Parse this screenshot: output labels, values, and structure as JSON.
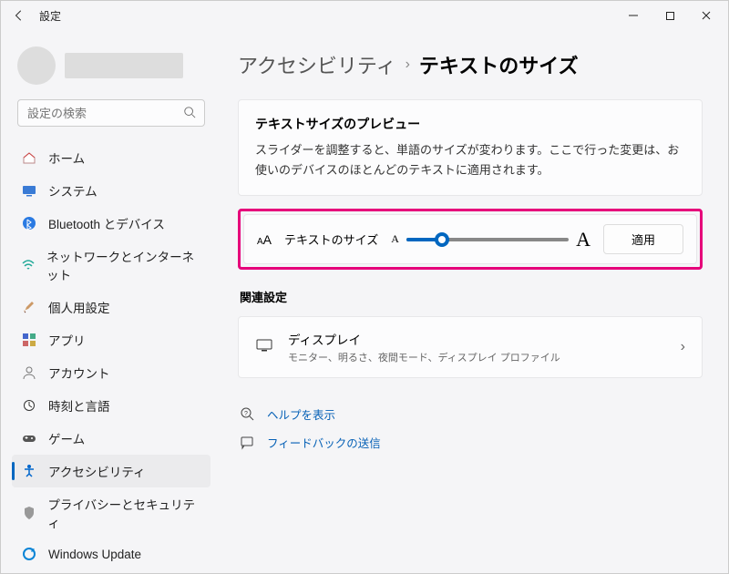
{
  "window": {
    "title": "設定"
  },
  "search": {
    "placeholder": "設定の検索"
  },
  "nav": {
    "items": [
      {
        "label": "ホーム"
      },
      {
        "label": "システム"
      },
      {
        "label": "Bluetooth とデバイス"
      },
      {
        "label": "ネットワークとインターネット"
      },
      {
        "label": "個人用設定"
      },
      {
        "label": "アプリ"
      },
      {
        "label": "アカウント"
      },
      {
        "label": "時刻と言語"
      },
      {
        "label": "ゲーム"
      },
      {
        "label": "アクセシビリティ"
      },
      {
        "label": "プライバシーとセキュリティ"
      },
      {
        "label": "Windows Update"
      }
    ]
  },
  "breadcrumb": {
    "parent": "アクセシビリティ",
    "current": "テキストのサイズ"
  },
  "preview": {
    "title": "テキストサイズのプレビュー",
    "description": "スライダーを調整すると、単語のサイズが変わります。ここで行った変更は、お使いのデバイスのほとんどのテキストに適用されます。"
  },
  "slider": {
    "label": "テキストのサイズ",
    "apply": "適用"
  },
  "related": {
    "heading": "関連設定",
    "display": {
      "title": "ディスプレイ",
      "sub": "モニター、明るさ、夜間モード、ディスプレイ プロファイル"
    }
  },
  "help": {
    "get_help": "ヘルプを表示",
    "feedback": "フィードバックの送信"
  }
}
